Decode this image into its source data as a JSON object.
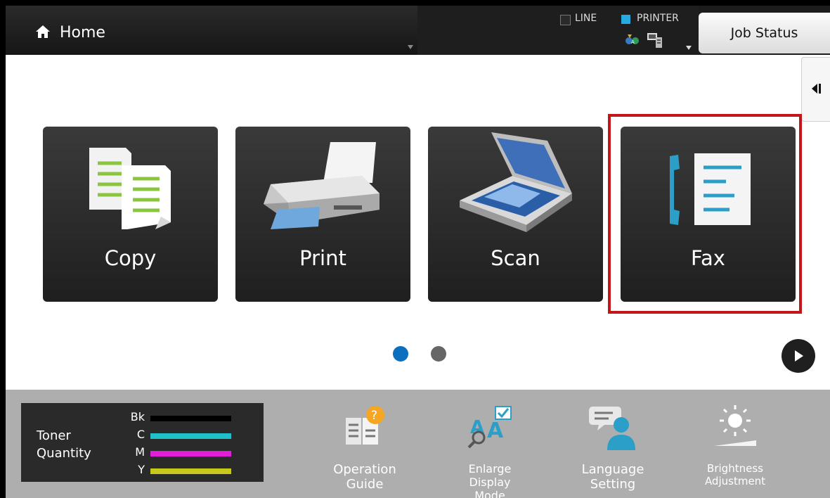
{
  "header": {
    "home_label": "Home",
    "line_label": "LINE",
    "printer_label": "PRINTER",
    "job_status_label": "Job Status",
    "printer_indicator_color": "#27aae1"
  },
  "tiles": [
    {
      "label": "Copy",
      "icon": "copy-icon"
    },
    {
      "label": "Print",
      "icon": "printer-icon"
    },
    {
      "label": "Scan",
      "icon": "scanner-icon"
    },
    {
      "label": "Fax",
      "icon": "fax-icon",
      "highlighted": true
    }
  ],
  "pagination": {
    "current_page": 1,
    "total_pages": 2,
    "active_color": "#0b6fbd",
    "inactive_color": "#666666"
  },
  "toner": {
    "title_line1": "Toner",
    "title_line2": "Quantity",
    "levels": [
      {
        "name": "Bk",
        "color": "#000000"
      },
      {
        "name": "C",
        "color": "#1fc0c8"
      },
      {
        "name": "M",
        "color": "#e020d8"
      },
      {
        "name": "Y",
        "color": "#c8c81a"
      }
    ]
  },
  "bottom_items": [
    {
      "label_line1": "Operation",
      "label_line2": "Guide",
      "icon": "operation-guide-icon"
    },
    {
      "label_line1": "Enlarge",
      "label_line2": "Display",
      "label_line3": "Mode",
      "icon": "enlarge-display-icon"
    },
    {
      "label_line1": "Language",
      "label_line2": "Setting",
      "icon": "language-icon"
    },
    {
      "label_line1": "Brightness",
      "label_line2": "Adjustment",
      "icon": "brightness-icon"
    }
  ],
  "highlight_color": "#c0161c"
}
